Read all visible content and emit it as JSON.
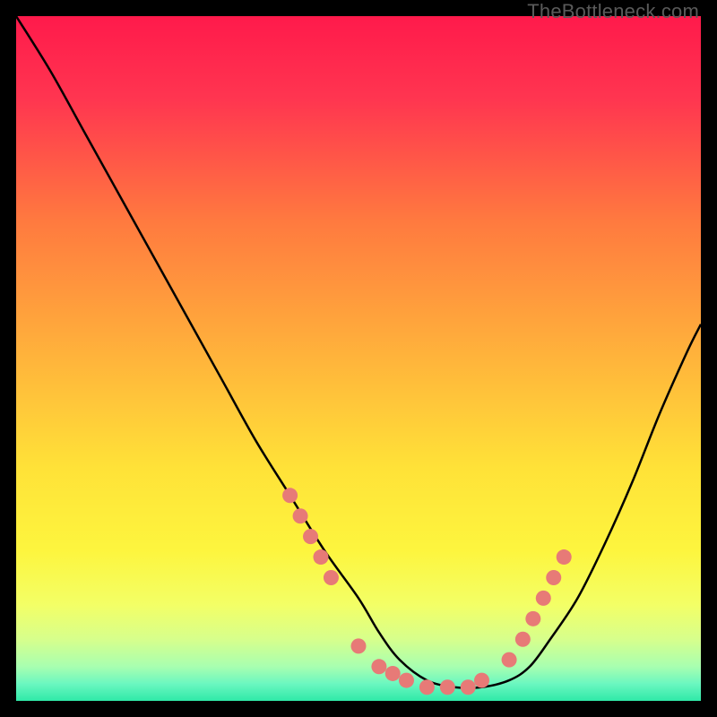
{
  "watermark": "TheBottleneck.com",
  "chart_data": {
    "type": "line",
    "title": "",
    "xlabel": "",
    "ylabel": "",
    "xlim": [
      0,
      100
    ],
    "ylim": [
      0,
      100
    ],
    "grid": false,
    "legend": false,
    "background_gradient": {
      "stops": [
        {
          "pos": 0.0,
          "color": "#ff1a4b"
        },
        {
          "pos": 0.12,
          "color": "#ff3550"
        },
        {
          "pos": 0.3,
          "color": "#ff7a3f"
        },
        {
          "pos": 0.5,
          "color": "#ffb43b"
        },
        {
          "pos": 0.66,
          "color": "#ffe238"
        },
        {
          "pos": 0.78,
          "color": "#fdf53e"
        },
        {
          "pos": 0.86,
          "color": "#f3ff66"
        },
        {
          "pos": 0.91,
          "color": "#d7ff8c"
        },
        {
          "pos": 0.95,
          "color": "#a8ffb0"
        },
        {
          "pos": 0.975,
          "color": "#6bf7c0"
        },
        {
          "pos": 1.0,
          "color": "#2fe9a8"
        }
      ]
    },
    "series": [
      {
        "name": "bottleneck-curve",
        "color": "#000000",
        "x": [
          0,
          5,
          10,
          15,
          20,
          25,
          30,
          35,
          40,
          45,
          50,
          53,
          56,
          60,
          64,
          68,
          72,
          75,
          78,
          82,
          86,
          90,
          94,
          98,
          100
        ],
        "y": [
          100,
          92,
          83,
          74,
          65,
          56,
          47,
          38,
          30,
          22,
          15,
          10,
          6,
          3,
          2,
          2,
          3,
          5,
          9,
          15,
          23,
          32,
          42,
          51,
          55
        ]
      },
      {
        "name": "highlight-dots",
        "type": "scatter",
        "color": "#e77a77",
        "x": [
          40,
          41.5,
          43,
          44.5,
          46,
          50,
          53,
          55,
          57,
          60,
          63,
          66,
          68,
          72,
          74,
          75.5,
          77,
          78.5,
          80
        ],
        "y": [
          30,
          27,
          24,
          21,
          18,
          8,
          5,
          4,
          3,
          2,
          2,
          2,
          3,
          6,
          9,
          12,
          15,
          18,
          21
        ]
      }
    ]
  }
}
